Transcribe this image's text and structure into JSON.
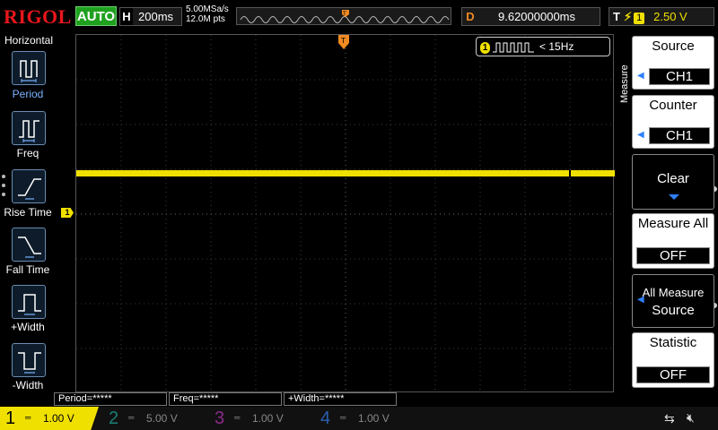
{
  "topbar": {
    "brand": "RIGOL",
    "run_status": "AUTO",
    "horizontal_label": "H",
    "timebase": "200ms",
    "sample_rate": "5.00MSa/s",
    "memory_depth": "12.0M pts",
    "delay_label": "D",
    "delay_value": "9.62000000ms",
    "trigger_label": "T",
    "trigger_channel": "1",
    "trigger_level": "2.50 V"
  },
  "left_menu": {
    "title": "Horizontal",
    "items": [
      {
        "label": "Period",
        "icon": "period-icon"
      },
      {
        "label": "Freq",
        "icon": "freq-icon"
      },
      {
        "label": "Rise Time",
        "icon": "rise-time-icon"
      },
      {
        "label": "Fall Time",
        "icon": "fall-time-icon"
      },
      {
        "label": "+Width",
        "icon": "positive-width-icon"
      },
      {
        "label": "-Width",
        "icon": "negative-width-icon"
      }
    ]
  },
  "display": {
    "ch1_marker": "1",
    "counter_channel": "1",
    "counter_value": "< 15Hz",
    "trace_color": "#f0e000"
  },
  "right_menu": {
    "title": "Measure",
    "source": {
      "label": "Source",
      "value": "CH1"
    },
    "counter": {
      "label": "Counter",
      "value": "CH1"
    },
    "clear": {
      "label": "Clear"
    },
    "measure_all": {
      "label": "Measure All",
      "value": "OFF"
    },
    "all_measure_source": {
      "label_line1": "All Measure",
      "label_line2": "Source"
    },
    "statistic": {
      "label": "Statistic",
      "value": "OFF"
    }
  },
  "results": [
    {
      "text": "Period=*****"
    },
    {
      "text": "Freq=*****"
    },
    {
      "text": "+Width=*****"
    }
  ],
  "channels": [
    {
      "num": "1",
      "scale": "1.00 V",
      "color": "#f0e000"
    },
    {
      "num": "2",
      "scale": "5.00 V",
      "color": "#1b7f75"
    },
    {
      "num": "3",
      "scale": "1.00 V",
      "color": "#8a2a8a"
    },
    {
      "num": "4",
      "scale": "1.00 V",
      "color": "#2a5fb0"
    }
  ]
}
